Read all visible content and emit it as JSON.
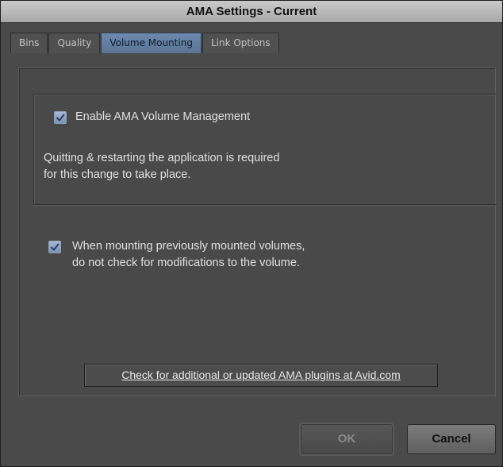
{
  "window": {
    "title": "AMA Settings - Current"
  },
  "tabs": [
    {
      "label": "Bins",
      "active": false
    },
    {
      "label": "Quality",
      "active": false
    },
    {
      "label": "Volume Mounting",
      "active": true
    },
    {
      "label": "Link Options",
      "active": false
    }
  ],
  "volume_management": {
    "checkbox_label": "Enable AMA Volume Management",
    "checked": true,
    "note_line1": "Quitting & restarting the application is required",
    "note_line2": "for this change to take place."
  },
  "modifications": {
    "checkbox_label_line1": "When mounting previously mounted volumes,",
    "checkbox_label_line2": "do not check for modifications to the volume.",
    "checked": true
  },
  "plugins_link": {
    "label": "Check for additional or updated AMA plugins at Avid.com"
  },
  "buttons": {
    "ok_label": "OK",
    "ok_enabled": false,
    "cancel_label": "Cancel"
  },
  "colors": {
    "active_tab": "#6d89ad",
    "checkbox": "#8fa5c6",
    "background": "#4a4a4a"
  }
}
